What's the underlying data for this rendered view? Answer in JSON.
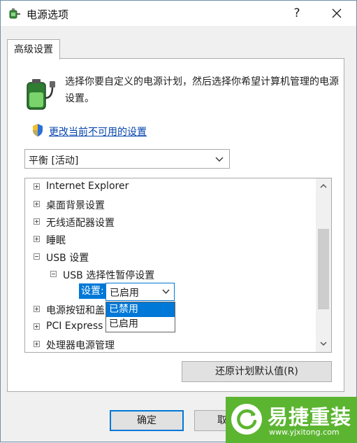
{
  "window": {
    "title": "电源选项",
    "help_glyph": "?",
    "close_glyph": "X"
  },
  "tabs": [
    {
      "label": "高级设置",
      "active": true
    }
  ],
  "intro": {
    "icon": "battery-plug-icon",
    "text": "选择你要自定义的电源计划，然后选择你希望计算机管理的电源设置。"
  },
  "change_link": {
    "icon": "uac-shield-icon",
    "text": "更改当前不可用的设置"
  },
  "plan_select": {
    "value": "平衡 [活动]"
  },
  "tree": {
    "items": [
      {
        "label": "Internet Explorer",
        "expander": "+"
      },
      {
        "label": "桌面背景设置",
        "expander": "+"
      },
      {
        "label": "无线适配器设置",
        "expander": "+"
      },
      {
        "label": "睡眠",
        "expander": "+"
      },
      {
        "label": "USB 设置",
        "expander": "-"
      },
      {
        "label": "USB 选择性暂停设置",
        "expander": "-"
      },
      {
        "label": "电源按钮和盖",
        "expander": "+"
      },
      {
        "label": "PCI Express",
        "expander": "+"
      },
      {
        "label": "处理器电源管理",
        "expander": "+"
      }
    ],
    "setting_label": "设置:",
    "setting_value": "已启用",
    "dropdown_options": [
      {
        "label": "已禁用",
        "highlighted": true
      },
      {
        "label": "已启用",
        "highlighted": false
      }
    ]
  },
  "buttons": {
    "restore": "还原计划默认值(R)",
    "ok": "确定",
    "cancel": "取"
  },
  "watermark": {
    "name": "易捷重装",
    "url": "www.yjxitong.com"
  },
  "colors": {
    "accent": "#0078d7",
    "link": "#0645ad",
    "watermark_bg": "#5cb531"
  }
}
